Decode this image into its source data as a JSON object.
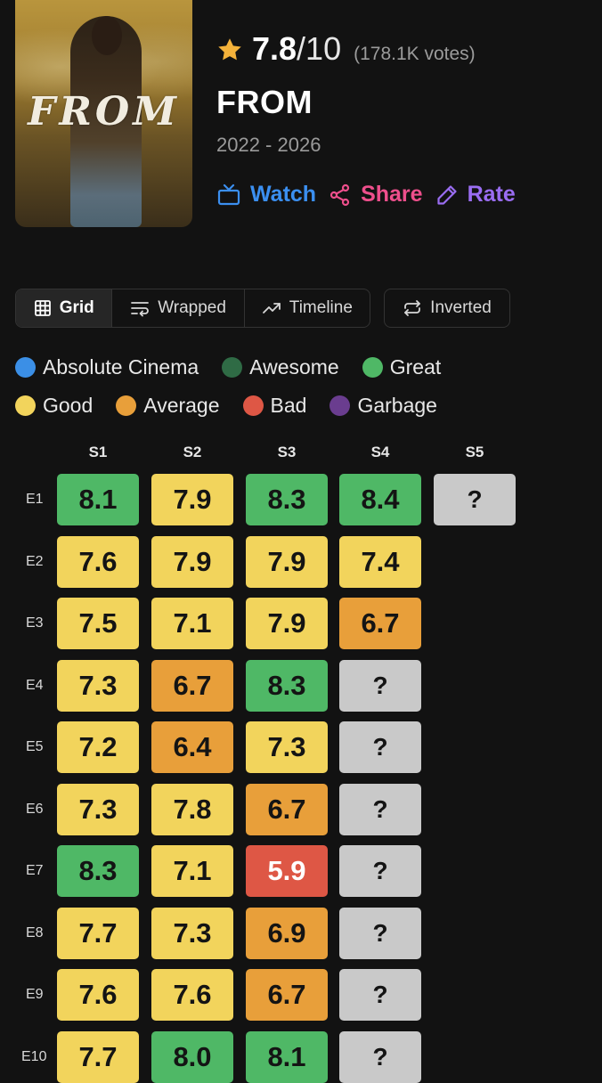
{
  "show": {
    "rating": "7.8",
    "rating_max": "/10",
    "votes": "(178.1K votes)",
    "title": "FROM",
    "years": "2022 - 2026",
    "poster_logo": "FROM"
  },
  "actions": {
    "watch": "Watch",
    "share": "Share",
    "rate": "Rate"
  },
  "views": {
    "grid": "Grid",
    "wrapped": "Wrapped",
    "timeline": "Timeline",
    "inverted": "Inverted",
    "active": "Grid"
  },
  "legend": [
    {
      "label": "Absolute Cinema",
      "color": "#3b8fe6"
    },
    {
      "label": "Awesome",
      "color": "#2f6b45"
    },
    {
      "label": "Great",
      "color": "#4fb866"
    },
    {
      "label": "Good",
      "color": "#f2d45c"
    },
    {
      "label": "Average",
      "color": "#e89f3a"
    },
    {
      "label": "Bad",
      "color": "#de5745"
    },
    {
      "label": "Garbage",
      "color": "#6a3d8f"
    }
  ],
  "grid": {
    "seasons": [
      "S1",
      "S2",
      "S3",
      "S4",
      "S5"
    ],
    "episodes": [
      "E1",
      "E2",
      "E3",
      "E4",
      "E5",
      "E6",
      "E7",
      "E8",
      "E9",
      "E10"
    ],
    "cells": [
      [
        [
          "8.1",
          "great"
        ],
        [
          "7.9",
          "good"
        ],
        [
          "8.3",
          "great"
        ],
        [
          "8.4",
          "great"
        ],
        [
          "?",
          "unknown"
        ]
      ],
      [
        [
          "7.6",
          "good"
        ],
        [
          "7.9",
          "good"
        ],
        [
          "7.9",
          "good"
        ],
        [
          "7.4",
          "good"
        ]
      ],
      [
        [
          "7.5",
          "good"
        ],
        [
          "7.1",
          "good"
        ],
        [
          "7.9",
          "good"
        ],
        [
          "6.7",
          "average"
        ]
      ],
      [
        [
          "7.3",
          "good"
        ],
        [
          "6.7",
          "average"
        ],
        [
          "8.3",
          "great"
        ],
        [
          "?",
          "unknown"
        ]
      ],
      [
        [
          "7.2",
          "good"
        ],
        [
          "6.4",
          "average"
        ],
        [
          "7.3",
          "good"
        ],
        [
          "?",
          "unknown"
        ]
      ],
      [
        [
          "7.3",
          "good"
        ],
        [
          "7.8",
          "good"
        ],
        [
          "6.7",
          "average"
        ],
        [
          "?",
          "unknown"
        ]
      ],
      [
        [
          "8.3",
          "great"
        ],
        [
          "7.1",
          "good"
        ],
        [
          "5.9",
          "bad"
        ],
        [
          "?",
          "unknown"
        ]
      ],
      [
        [
          "7.7",
          "good"
        ],
        [
          "7.3",
          "good"
        ],
        [
          "6.9",
          "average"
        ],
        [
          "?",
          "unknown"
        ]
      ],
      [
        [
          "7.6",
          "good"
        ],
        [
          "7.6",
          "good"
        ],
        [
          "6.7",
          "average"
        ],
        [
          "?",
          "unknown"
        ]
      ],
      [
        [
          "7.7",
          "good"
        ],
        [
          "8.0",
          "great"
        ],
        [
          "8.1",
          "great"
        ],
        [
          "?",
          "unknown"
        ]
      ]
    ]
  },
  "colors": {
    "great": "#4fb866",
    "good": "#f2d45c",
    "average": "#e89f3a",
    "bad": "#de5745",
    "unknown": "#c9c9c9",
    "star": "#f4b23a"
  }
}
